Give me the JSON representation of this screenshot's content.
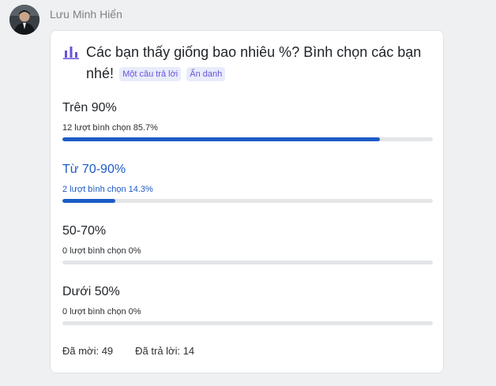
{
  "post": {
    "author": "Lưu Minh Hiển",
    "avatar_icon": "user-avatar"
  },
  "poll": {
    "icon": "poll-bars-icon",
    "question": "Các bạn thấy giống bao nhiêu %? Bình chọn các bạn nhé!",
    "tags": [
      "Một câu trả lời",
      "Ẩn danh"
    ],
    "accent_color": "#1d5bc7",
    "options": [
      {
        "label": "Trên 90%",
        "votes": "12 lượt bình chọn",
        "percent_text": "85.7%",
        "percent": 85.7,
        "selected": false
      },
      {
        "label": "Từ 70-90%",
        "votes": "2 lượt bình chọn",
        "percent_text": "14.3%",
        "percent": 14.3,
        "selected": true
      },
      {
        "label": "50-70%",
        "votes": "0 lượt bình chọn",
        "percent_text": "0%",
        "percent": 0,
        "selected": false
      },
      {
        "label": "Dưới 50%",
        "votes": "0 lượt bình chọn",
        "percent_text": "0%",
        "percent": 0,
        "selected": false
      }
    ],
    "footer": {
      "invited": "Đã mời: 49",
      "answered": "Đã trả lời: 14"
    }
  }
}
